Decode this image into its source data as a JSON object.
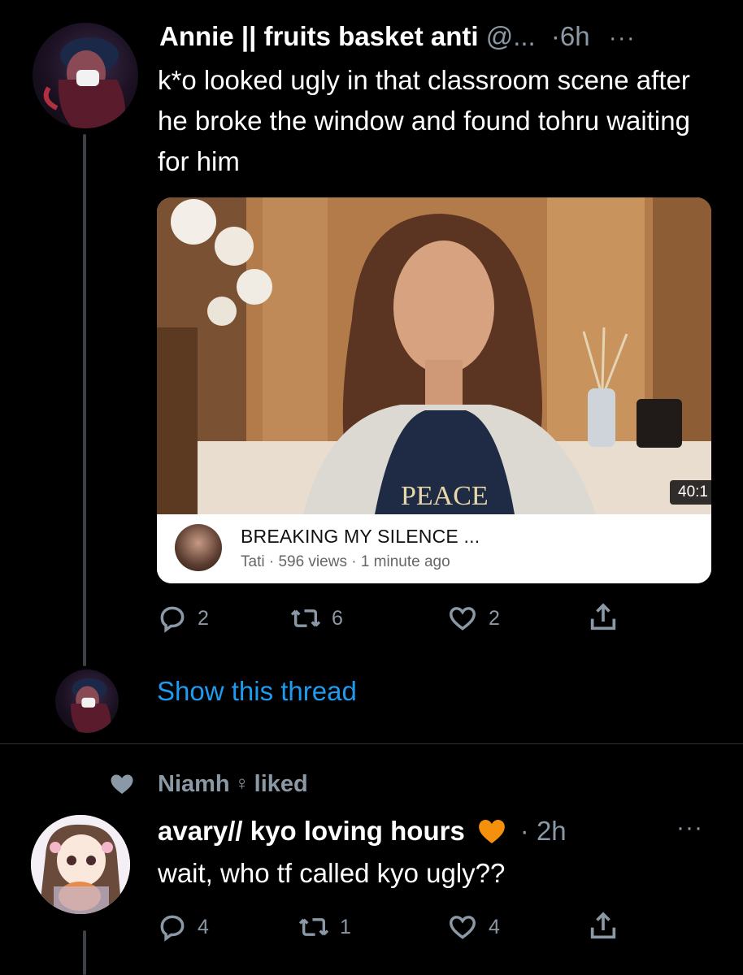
{
  "tweet1": {
    "display_name": "Annie || fruits basket anti",
    "handle": "@...",
    "time": "·6h",
    "more": "···",
    "text": "k*o looked ugly in that classroom scene after he broke the window and found tohru waiting for him",
    "card": {
      "duration": "40:1",
      "shirt_text": "PEACE",
      "title": "BREAKING MY SILENCE ...",
      "subtitle": "Tati · 596 views · 1 minute ago"
    },
    "actions": {
      "replies": "2",
      "retweets": "6",
      "likes": "2"
    }
  },
  "show_thread": "Show this thread",
  "liked_context": {
    "name": "Niamh",
    "symbol": "♀",
    "verb": "liked"
  },
  "tweet2": {
    "display_name": "avary// kyo loving hours",
    "time": "· 2h",
    "more": "···",
    "text": "wait, who tf called kyo ugly??",
    "actions": {
      "replies": "4",
      "retweets": "1",
      "likes": "4"
    }
  },
  "colors": {
    "background": "#000000",
    "muted": "#8b98a5",
    "link": "#1d9bf0",
    "heart_emoji": "#f4900c"
  }
}
